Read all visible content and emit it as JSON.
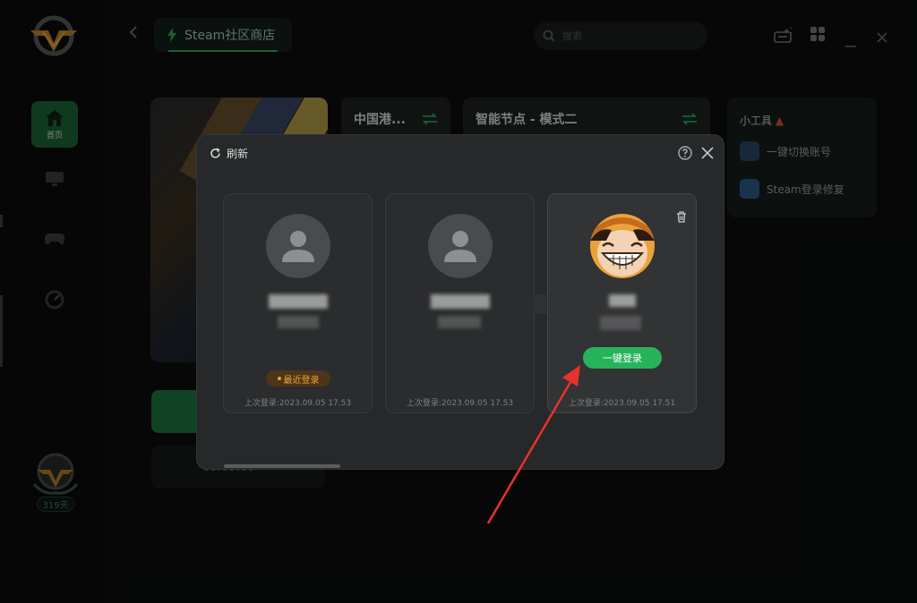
{
  "sidebar": {
    "logo_icon": "winged-v-logo-icon",
    "items": [
      {
        "label": "首页",
        "icon": "home-icon",
        "active": true
      },
      {
        "label": "",
        "icon": "monitor-icon",
        "active": false
      },
      {
        "label": "",
        "icon": "gamepad-icon",
        "active": false
      },
      {
        "label": "",
        "icon": "speedometer-icon",
        "active": false
      }
    ],
    "member_badge": {
      "icon": "winged-v-badge-icon",
      "days": "319天"
    }
  },
  "topbar": {
    "back_icon": "chevron-left-icon",
    "active_tab": "Steam社区商店",
    "tab_icon": "lightning-icon",
    "search_placeholder": "搜索",
    "icons": [
      "download-plus-icon",
      "grid-icon",
      "minimize-icon",
      "close-icon"
    ]
  },
  "background": {
    "node_cards": [
      "中国港...",
      "智能节点 - 模式二"
    ],
    "tools_title": "小工具",
    "tools": [
      "一键切换账号",
      "Steam登录修复"
    ],
    "timer": "00:05:00"
  },
  "modal": {
    "refresh_label": "刷新",
    "accounts": [
      {
        "last_login": "上次登录:2023.09.05 17.53",
        "recent_badge": "最近登录",
        "avatar": "default-user-avatar",
        "selected": false
      },
      {
        "last_login": "上次登录:2023.09.05 17.53",
        "recent_badge": "",
        "avatar": "default-user-avatar",
        "selected": false
      },
      {
        "last_login": "上次登录:2023.09.05 17.51",
        "recent_badge": "",
        "avatar": "anime-character-avatar",
        "selected": true,
        "login_button": "一键登录"
      }
    ]
  },
  "colors": {
    "accent_green": "#27b35c",
    "recent_orange": "#f0a233",
    "arrow_red": "#e8322b"
  }
}
